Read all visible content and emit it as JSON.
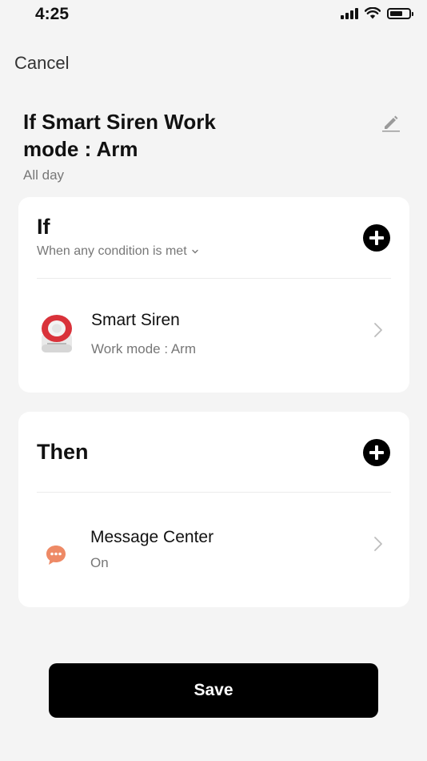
{
  "status_bar": {
    "time": "4:25"
  },
  "header": {
    "cancel_label": "Cancel"
  },
  "scene": {
    "title": "If Smart Siren  Work\nmode :  Arm",
    "schedule": "All day"
  },
  "if_section": {
    "heading": "If",
    "condition_mode": "When any condition is met",
    "conditions": [
      {
        "device_name": "Smart Siren",
        "detail": "Work mode :  Arm",
        "icon": "siren-icon"
      }
    ]
  },
  "then_section": {
    "heading": "Then",
    "actions": [
      {
        "name": "Message Center",
        "detail": "On",
        "icon": "message-icon"
      }
    ]
  },
  "footer": {
    "save_label": "Save"
  },
  "colors": {
    "background": "#f4f4f4",
    "card": "#ffffff",
    "primary": "#000000",
    "message_icon": "#ee8a66",
    "siren_ring": "#d9323a"
  }
}
